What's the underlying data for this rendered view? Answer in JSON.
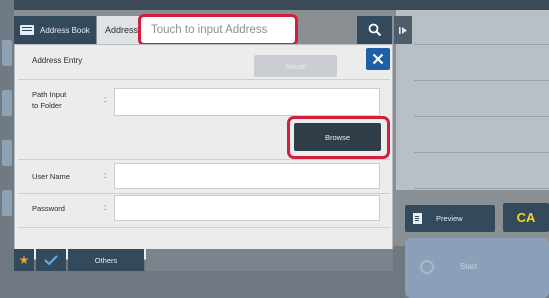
{
  "header": {
    "tab_address_book": "Address Book",
    "tab_address": "Address",
    "address_placeholder": "Touch to input Address",
    "next_icon": "play-next-icon"
  },
  "dialog": {
    "title": "Address Entry",
    "recall_label": "Recall",
    "path_label_line1": "Path Input",
    "path_label_line2": "to Folder",
    "browse_label": "Browse",
    "user_name_label": "User Name",
    "password_label": "Password",
    "colon": ":"
  },
  "bottom_tabs": {
    "others_label": "Others"
  },
  "right_panel": {
    "preview_label": "Preview",
    "ca_label": "CA",
    "start_label": "Start"
  },
  "colors": {
    "highlight": "#d21f3c",
    "tab_dark": "#33495c",
    "close_blue": "#1e5fa6",
    "ca_yellow": "#ffd31a",
    "star": "#f0a21f"
  }
}
